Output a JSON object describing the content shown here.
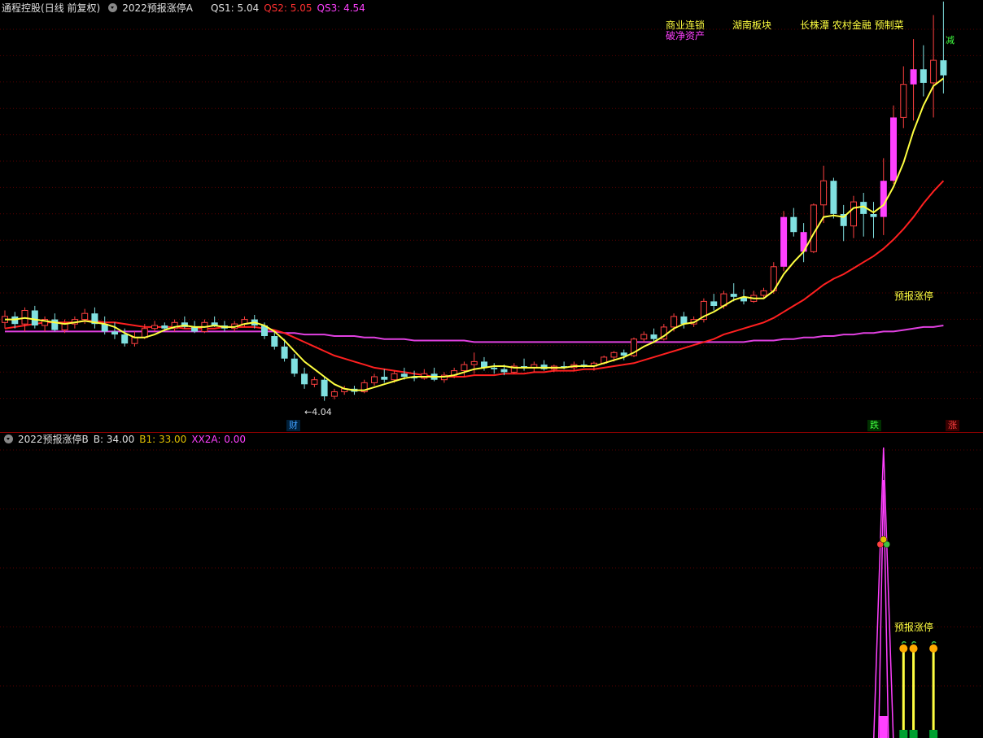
{
  "main_panel": {
    "stock_name": "通程控股",
    "period_info": "(日线 前复权)",
    "indicator_name": "2022预报涨停A",
    "values": [
      {
        "label": "QS1: 5.04",
        "color": "#e0e0e0"
      },
      {
        "label": "QS2: 5.05",
        "color": "#ff3030"
      },
      {
        "label": "QS3: 4.54",
        "color": "#ff40ff"
      }
    ],
    "concepts_row1": [
      {
        "text": "商业连锁",
        "color": "#ffff40"
      },
      {
        "text": "湖南板块",
        "color": "#ffff40"
      },
      {
        "text": "长株潭 农村金融 预制菜",
        "color": "#ffff40"
      }
    ],
    "concept_row2": {
      "text": "破净资产",
      "color": "#ff40ff"
    },
    "low_label": "4.04",
    "signal_label": "预报涨停",
    "markers": [
      {
        "text": "财",
        "color": "#40a0ff",
        "bg": "#003050"
      },
      {
        "text": "跌",
        "color": "#40ff40",
        "bg": "#004000"
      },
      {
        "text": "涨",
        "color": "#ff4040",
        "bg": "#400000"
      },
      {
        "text": "减",
        "color": "#40ff40",
        "bg": "#000000"
      }
    ]
  },
  "sub_panel": {
    "indicator_name": "2022预报涨停B",
    "values": [
      {
        "label": "B: 34.00",
        "color": "#e0e0e0"
      },
      {
        "label": "B1: 33.00",
        "color": "#e0c000"
      },
      {
        "label": "XX2A: 0.00",
        "color": "#ff40ff"
      }
    ],
    "signal_label": "预报涨停"
  },
  "colors": {
    "up": "#ff4040",
    "down": "#80e0e0",
    "limit": "#ff40ff",
    "ma_short": "#ffff40",
    "ma_mid": "#ff2020",
    "ma_long": "#e040e0",
    "grid": "#5a0000",
    "divider": "#8b0000"
  },
  "chart_data": {
    "type": "candlestick",
    "ohlc": [
      [
        4.56,
        4.64,
        4.52,
        4.6
      ],
      [
        4.6,
        4.63,
        4.52,
        4.55
      ],
      [
        4.55,
        4.66,
        4.5,
        4.64
      ],
      [
        4.64,
        4.67,
        4.52,
        4.54
      ],
      [
        4.54,
        4.6,
        4.5,
        4.58
      ],
      [
        4.58,
        4.62,
        4.5,
        4.51
      ],
      [
        4.51,
        4.58,
        4.49,
        4.55
      ],
      [
        4.55,
        4.6,
        4.52,
        4.58
      ],
      [
        4.58,
        4.65,
        4.55,
        4.62
      ],
      [
        4.62,
        4.66,
        4.52,
        4.55
      ],
      [
        4.55,
        4.6,
        4.48,
        4.5
      ],
      [
        4.5,
        4.56,
        4.45,
        4.48
      ],
      [
        4.48,
        4.52,
        4.4,
        4.42
      ],
      [
        4.42,
        4.5,
        4.4,
        4.46
      ],
      [
        4.46,
        4.55,
        4.45,
        4.52
      ],
      [
        4.52,
        4.57,
        4.5,
        4.54
      ],
      [
        4.54,
        4.56,
        4.5,
        4.52
      ],
      [
        4.52,
        4.58,
        4.5,
        4.56
      ],
      [
        4.56,
        4.6,
        4.52,
        4.53
      ],
      [
        4.53,
        4.57,
        4.49,
        4.5
      ],
      [
        4.5,
        4.58,
        4.49,
        4.56
      ],
      [
        4.56,
        4.6,
        4.53,
        4.54
      ],
      [
        4.54,
        4.57,
        4.5,
        4.52
      ],
      [
        4.52,
        4.57,
        4.5,
        4.55
      ],
      [
        4.55,
        4.6,
        4.53,
        4.58
      ],
      [
        4.58,
        4.61,
        4.52,
        4.54
      ],
      [
        4.54,
        4.56,
        4.45,
        4.47
      ],
      [
        4.47,
        4.5,
        4.38,
        4.4
      ],
      [
        4.4,
        4.45,
        4.3,
        4.32
      ],
      [
        4.32,
        4.35,
        4.2,
        4.22
      ],
      [
        4.22,
        4.26,
        4.12,
        4.15
      ],
      [
        4.15,
        4.2,
        4.13,
        4.18
      ],
      [
        4.18,
        4.2,
        4.04,
        4.07
      ],
      [
        4.07,
        4.12,
        4.05,
        4.1
      ],
      [
        4.1,
        4.14,
        4.08,
        4.12
      ],
      [
        4.12,
        4.14,
        4.08,
        4.1
      ],
      [
        4.1,
        4.18,
        4.09,
        4.16
      ],
      [
        4.16,
        4.22,
        4.14,
        4.2
      ],
      [
        4.2,
        4.25,
        4.16,
        4.18
      ],
      [
        4.18,
        4.24,
        4.16,
        4.22
      ],
      [
        4.22,
        4.26,
        4.18,
        4.2
      ],
      [
        4.2,
        4.24,
        4.17,
        4.19
      ],
      [
        4.19,
        4.25,
        4.18,
        4.22
      ],
      [
        4.22,
        4.26,
        4.17,
        4.18
      ],
      [
        4.18,
        4.23,
        4.16,
        4.21
      ],
      [
        4.21,
        4.26,
        4.19,
        4.24
      ],
      [
        4.24,
        4.3,
        4.2,
        4.28
      ],
      [
        4.28,
        4.36,
        4.22,
        4.3
      ],
      [
        4.3,
        4.33,
        4.24,
        4.26
      ],
      [
        4.26,
        4.29,
        4.22,
        4.25
      ],
      [
        4.25,
        4.28,
        4.21,
        4.23
      ],
      [
        4.23,
        4.29,
        4.22,
        4.27
      ],
      [
        4.27,
        4.32,
        4.24,
        4.26
      ],
      [
        4.26,
        4.3,
        4.23,
        4.28
      ],
      [
        4.28,
        4.31,
        4.24,
        4.25
      ],
      [
        4.25,
        4.28,
        4.23,
        4.27
      ],
      [
        4.27,
        4.3,
        4.25,
        4.26
      ],
      [
        4.26,
        4.3,
        4.24,
        4.28
      ],
      [
        4.28,
        4.31,
        4.26,
        4.27
      ],
      [
        4.27,
        4.3,
        4.24,
        4.29
      ],
      [
        4.29,
        4.34,
        4.28,
        4.33
      ],
      [
        4.33,
        4.37,
        4.3,
        4.36
      ],
      [
        4.36,
        4.38,
        4.31,
        4.34
      ],
      [
        4.34,
        4.46,
        4.33,
        4.45
      ],
      [
        4.45,
        4.5,
        4.43,
        4.48
      ],
      [
        4.48,
        4.52,
        4.43,
        4.45
      ],
      [
        4.45,
        4.55,
        4.44,
        4.53
      ],
      [
        4.53,
        4.62,
        4.5,
        4.6
      ],
      [
        4.6,
        4.63,
        4.52,
        4.55
      ],
      [
        4.55,
        4.6,
        4.53,
        4.58
      ],
      [
        4.58,
        4.72,
        4.56,
        4.7
      ],
      [
        4.7,
        4.75,
        4.64,
        4.67
      ],
      [
        4.67,
        4.77,
        4.65,
        4.75
      ],
      [
        4.75,
        4.82,
        4.7,
        4.73
      ],
      [
        4.73,
        4.78,
        4.68,
        4.7
      ],
      [
        4.7,
        4.77,
        4.69,
        4.74
      ],
      [
        4.74,
        4.79,
        4.72,
        4.77
      ],
      [
        4.77,
        4.96,
        4.75,
        4.93
      ],
      [
        4.93,
        5.3,
        4.9,
        5.26
      ],
      [
        5.26,
        5.32,
        5.13,
        5.16
      ],
      [
        5.16,
        5.22,
        4.96,
        5.03
      ],
      [
        5.03,
        5.35,
        5.02,
        5.34
      ],
      [
        5.34,
        5.6,
        5.22,
        5.5
      ],
      [
        5.5,
        5.52,
        5.25,
        5.28
      ],
      [
        5.28,
        5.34,
        5.1,
        5.2
      ],
      [
        5.2,
        5.4,
        5.12,
        5.36
      ],
      [
        5.36,
        5.42,
        5.13,
        5.28
      ],
      [
        5.28,
        5.36,
        5.12,
        5.26
      ],
      [
        5.26,
        5.65,
        5.14,
        5.5
      ],
      [
        5.5,
        6.0,
        5.48,
        5.92
      ],
      [
        5.92,
        6.26,
        5.85,
        6.14
      ],
      [
        6.14,
        6.44,
        5.9,
        6.24
      ],
      [
        6.24,
        6.4,
        6.06,
        6.15
      ],
      [
        6.15,
        6.6,
        5.92,
        6.3
      ],
      [
        6.3,
        6.69,
        6.08,
        6.2
      ]
    ],
    "ma_short": [
      4.58,
      4.58,
      4.59,
      4.58,
      4.57,
      4.56,
      4.55,
      4.56,
      4.57,
      4.56,
      4.55,
      4.53,
      4.49,
      4.46,
      4.46,
      4.48,
      4.51,
      4.53,
      4.54,
      4.53,
      4.53,
      4.54,
      4.53,
      4.53,
      4.55,
      4.56,
      4.54,
      4.5,
      4.44,
      4.37,
      4.3,
      4.25,
      4.2,
      4.15,
      4.12,
      4.11,
      4.11,
      4.13,
      4.15,
      4.17,
      4.19,
      4.2,
      4.2,
      4.2,
      4.2,
      4.21,
      4.23,
      4.25,
      4.26,
      4.27,
      4.27,
      4.26,
      4.26,
      4.26,
      4.26,
      4.26,
      4.26,
      4.27,
      4.27,
      4.27,
      4.29,
      4.31,
      4.33,
      4.36,
      4.4,
      4.43,
      4.47,
      4.52,
      4.55,
      4.56,
      4.6,
      4.63,
      4.67,
      4.71,
      4.73,
      4.72,
      4.72,
      4.77,
      4.88,
      4.96,
      5.03,
      5.15,
      5.26,
      5.27,
      5.26,
      5.32,
      5.33,
      5.29,
      5.34,
      5.46,
      5.62,
      5.83,
      6.0,
      6.13,
      6.18
    ],
    "ma_mid": [
      4.52,
      4.53,
      4.54,
      4.55,
      4.56,
      4.56,
      4.56,
      4.56,
      4.57,
      4.57,
      4.56,
      4.56,
      4.55,
      4.54,
      4.53,
      4.53,
      4.53,
      4.53,
      4.52,
      4.52,
      4.52,
      4.52,
      4.53,
      4.53,
      4.53,
      4.53,
      4.52,
      4.51,
      4.49,
      4.46,
      4.43,
      4.4,
      4.37,
      4.34,
      4.32,
      4.3,
      4.28,
      4.26,
      4.25,
      4.24,
      4.23,
      4.22,
      4.21,
      4.2,
      4.2,
      4.2,
      4.2,
      4.21,
      4.21,
      4.21,
      4.22,
      4.22,
      4.22,
      4.23,
      4.23,
      4.24,
      4.24,
      4.24,
      4.25,
      4.25,
      4.26,
      4.27,
      4.28,
      4.29,
      4.31,
      4.33,
      4.35,
      4.37,
      4.39,
      4.41,
      4.43,
      4.45,
      4.48,
      4.5,
      4.52,
      4.54,
      4.56,
      4.59,
      4.63,
      4.67,
      4.71,
      4.76,
      4.81,
      4.85,
      4.88,
      4.92,
      4.96,
      5.0,
      5.05,
      5.11,
      5.18,
      5.26,
      5.35,
      5.43,
      5.5
    ],
    "ma_long": [
      4.5,
      4.5,
      4.5,
      4.5,
      4.5,
      4.5,
      4.5,
      4.5,
      4.5,
      4.5,
      4.5,
      4.5,
      4.5,
      4.5,
      4.5,
      4.5,
      4.5,
      4.5,
      4.5,
      4.5,
      4.5,
      4.5,
      4.5,
      4.5,
      4.5,
      4.5,
      4.5,
      4.5,
      4.49,
      4.49,
      4.48,
      4.48,
      4.48,
      4.47,
      4.47,
      4.47,
      4.46,
      4.46,
      4.45,
      4.45,
      4.45,
      4.44,
      4.44,
      4.44,
      4.44,
      4.44,
      4.44,
      4.43,
      4.43,
      4.43,
      4.43,
      4.43,
      4.43,
      4.43,
      4.43,
      4.43,
      4.43,
      4.43,
      4.43,
      4.43,
      4.43,
      4.43,
      4.43,
      4.43,
      4.43,
      4.43,
      4.43,
      4.43,
      4.43,
      4.43,
      4.43,
      4.43,
      4.43,
      4.43,
      4.43,
      4.44,
      4.44,
      4.44,
      4.45,
      4.45,
      4.46,
      4.46,
      4.47,
      4.47,
      4.48,
      4.48,
      4.49,
      4.49,
      4.5,
      4.5,
      4.51,
      4.52,
      4.53,
      4.53,
      4.54
    ],
    "limit_up_index": [
      78,
      80,
      88,
      89,
      91
    ],
    "price_range": [
      4.0,
      6.7
    ],
    "sub_indicator": {
      "spike_index": 88,
      "spike_peak": 34.0,
      "signal_bars": [
        90,
        91,
        93
      ]
    }
  }
}
